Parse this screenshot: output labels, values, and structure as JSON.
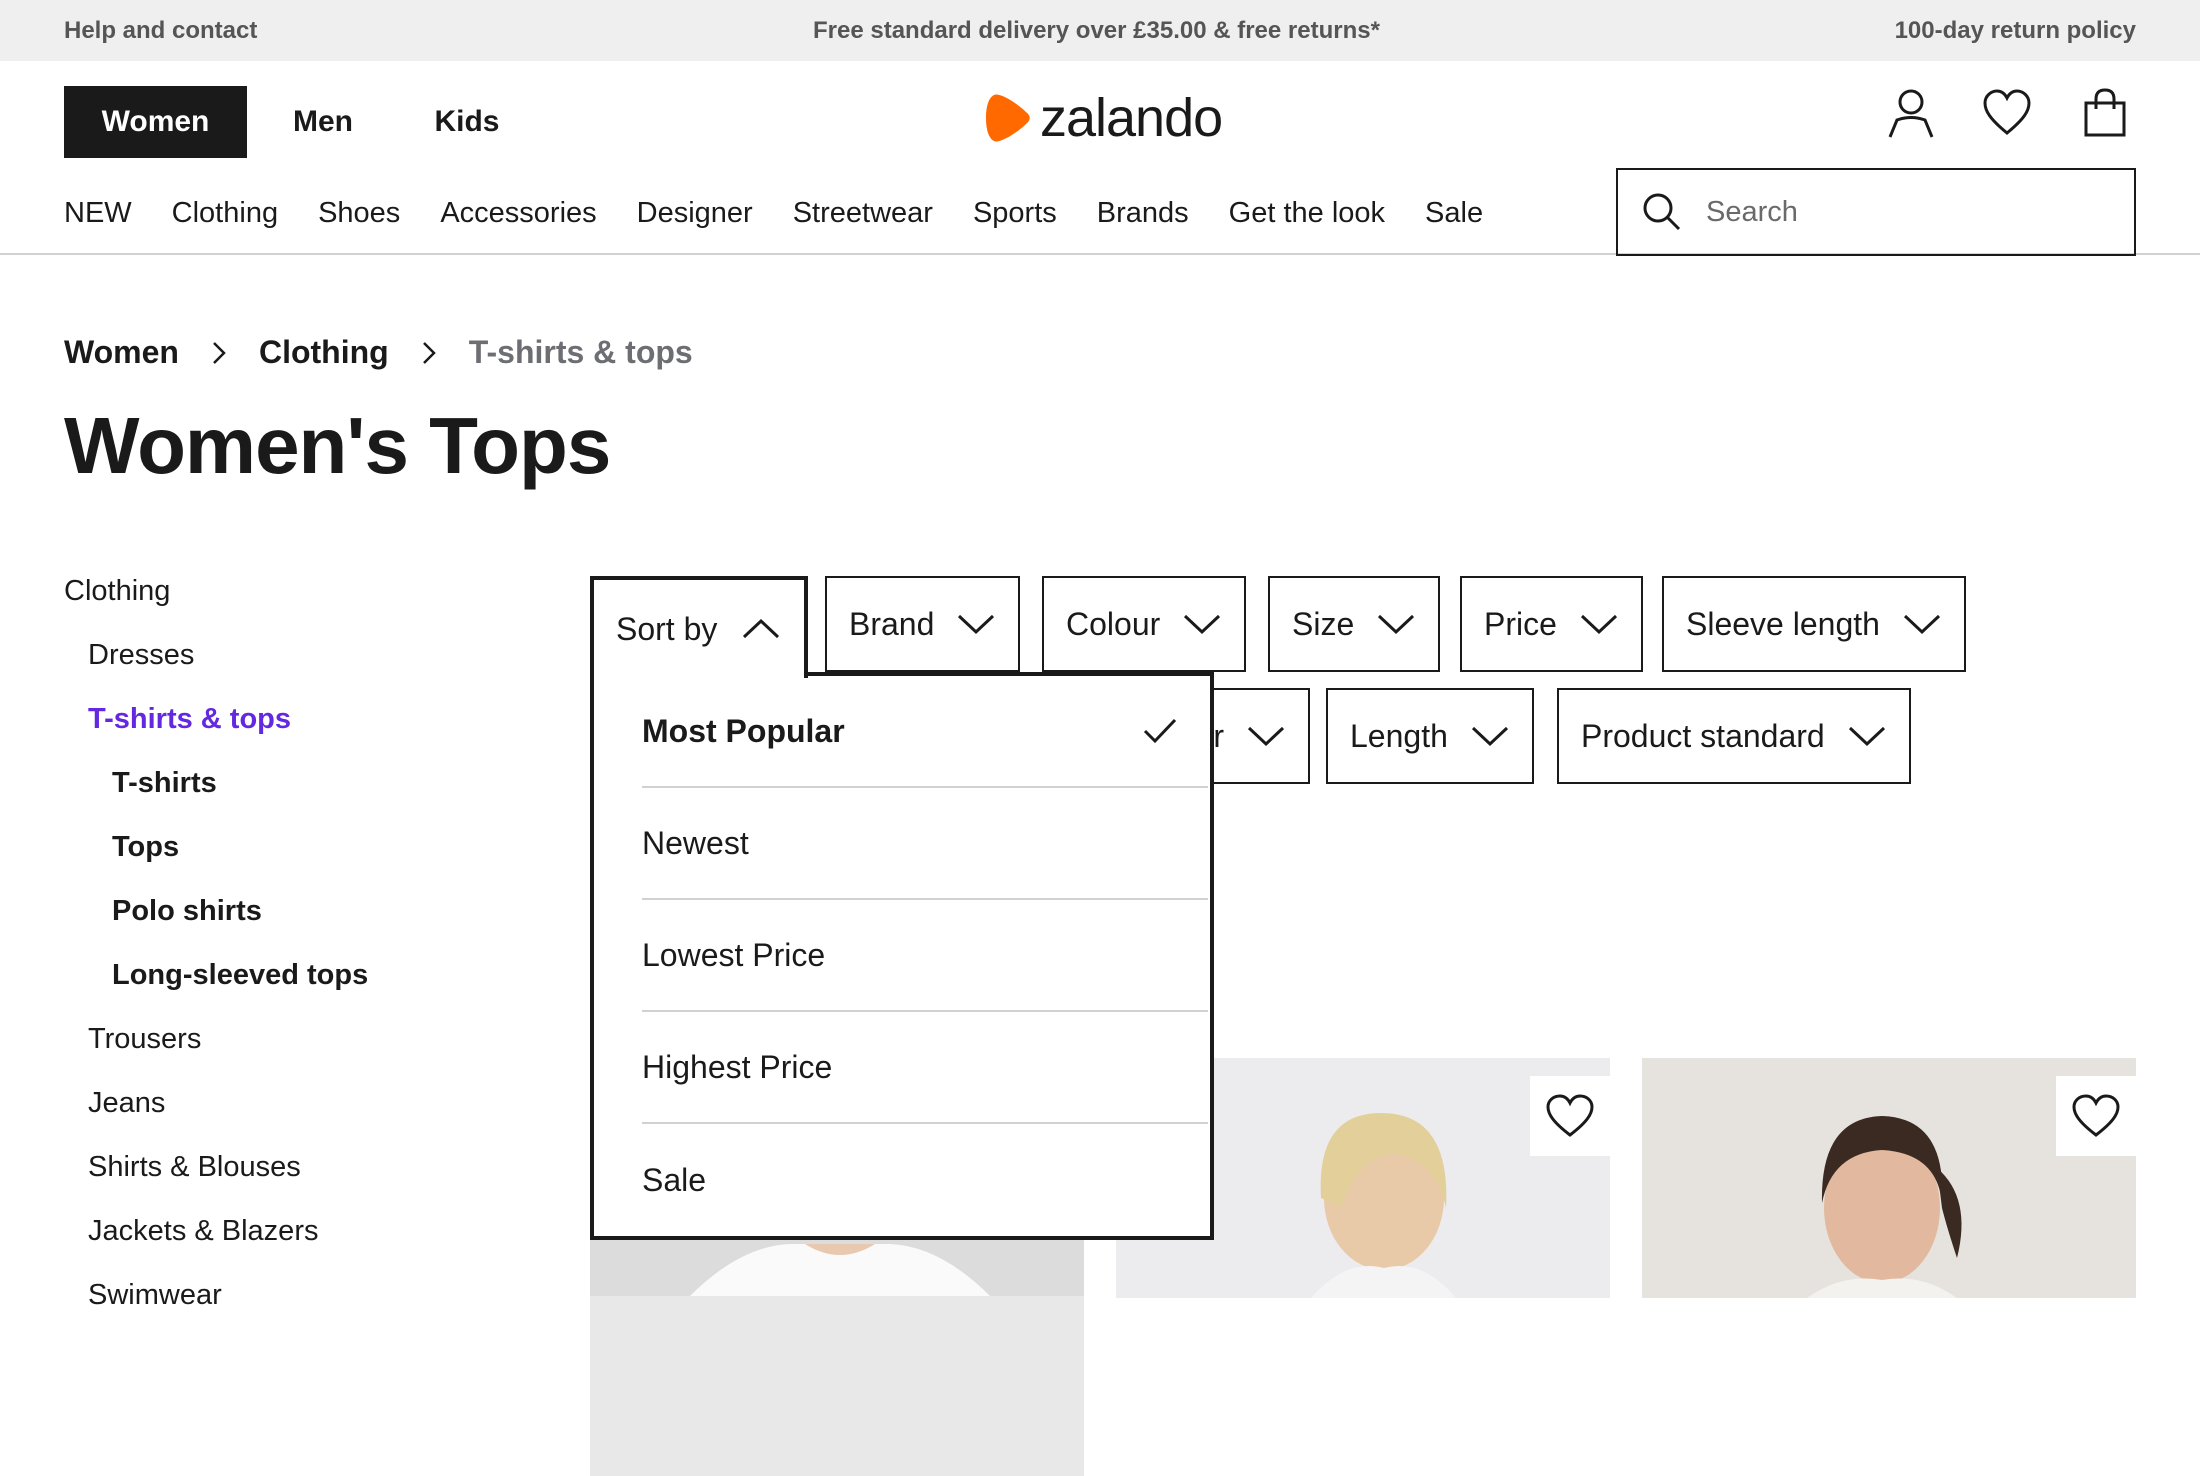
{
  "topbar": {
    "help": "Help and contact",
    "delivery": "Free standard delivery over £35.00 & free returns*",
    "returns": "100-day return policy"
  },
  "header": {
    "gender_tabs": [
      "Women",
      "Men",
      "Kids"
    ],
    "logo_text": "zalando",
    "brand_color": "#ff6900",
    "icons": [
      "user-icon",
      "heart-icon",
      "bag-icon"
    ],
    "categories": [
      "NEW",
      "Clothing",
      "Shoes",
      "Accessories",
      "Designer",
      "Streetwear",
      "Sports",
      "Brands",
      "Get the look",
      "Sale"
    ],
    "search_placeholder": "Search"
  },
  "breadcrumb": [
    "Women",
    "Clothing",
    "T-shirts & tops"
  ],
  "page_title": "Women's Tops",
  "sidebar": {
    "heading": "Clothing",
    "items": [
      {
        "label": "Dresses"
      },
      {
        "label": "T-shirts & tops",
        "active": true
      },
      {
        "label": "T-shirts"
      },
      {
        "label": "Tops"
      },
      {
        "label": "Polo shirts"
      },
      {
        "label": "Long-sleeved tops"
      },
      {
        "label": "Trousers"
      },
      {
        "label": "Jeans"
      },
      {
        "label": "Shirts & Blouses"
      },
      {
        "label": "Jackets & Blazers"
      },
      {
        "label": "Swimwear"
      }
    ],
    "active_color": "#6328e0"
  },
  "filters": {
    "sort_label": "Sort by",
    "row1": [
      "Brand",
      "Colour",
      "Size",
      "Price",
      "Sleeve length"
    ],
    "row2": [
      "r",
      "Length",
      "Product standard"
    ]
  },
  "sort_options": [
    {
      "label": "Most Popular",
      "selected": true
    },
    {
      "label": "Newest"
    },
    {
      "label": "Lowest Price"
    },
    {
      "label": "Highest Price"
    },
    {
      "label": "Sale"
    }
  ]
}
